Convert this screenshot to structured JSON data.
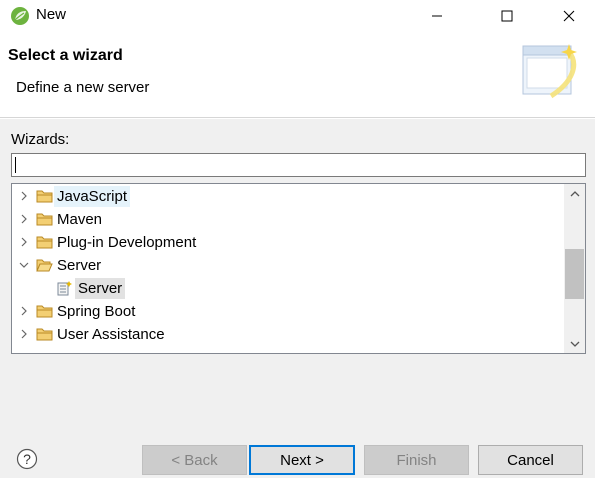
{
  "window": {
    "title": "New",
    "icon": "spring-leaf-icon",
    "controls": [
      "minimize-icon",
      "maximize-icon",
      "close-icon"
    ]
  },
  "banner": {
    "title": "Select a wizard",
    "description": "Define a new server"
  },
  "wizards": {
    "label": "Wizards:",
    "filter_value": "",
    "tree": [
      {
        "label": "JavaScript",
        "expanded": false,
        "level": 0,
        "icon": "folder-icon",
        "highlight": "hover"
      },
      {
        "label": "Maven",
        "expanded": false,
        "level": 0,
        "icon": "folder-icon"
      },
      {
        "label": "Plug-in Development",
        "expanded": false,
        "level": 0,
        "icon": "folder-icon"
      },
      {
        "label": "Server",
        "expanded": true,
        "level": 0,
        "icon": "folder-icon"
      },
      {
        "label": "Server",
        "level": 1,
        "icon": "server-wizard-icon",
        "highlight": "selected"
      },
      {
        "label": "Spring Boot",
        "expanded": false,
        "level": 0,
        "icon": "folder-icon"
      },
      {
        "label": "User Assistance",
        "expanded": false,
        "level": 0,
        "icon": "folder-icon"
      }
    ]
  },
  "buttons": {
    "back": "< Back",
    "next": "Next >",
    "finish": "Finish",
    "cancel": "Cancel"
  },
  "colors": {
    "accent": "#0078d7",
    "folder": "#e8b64c",
    "spring_green": "#6db33f"
  }
}
